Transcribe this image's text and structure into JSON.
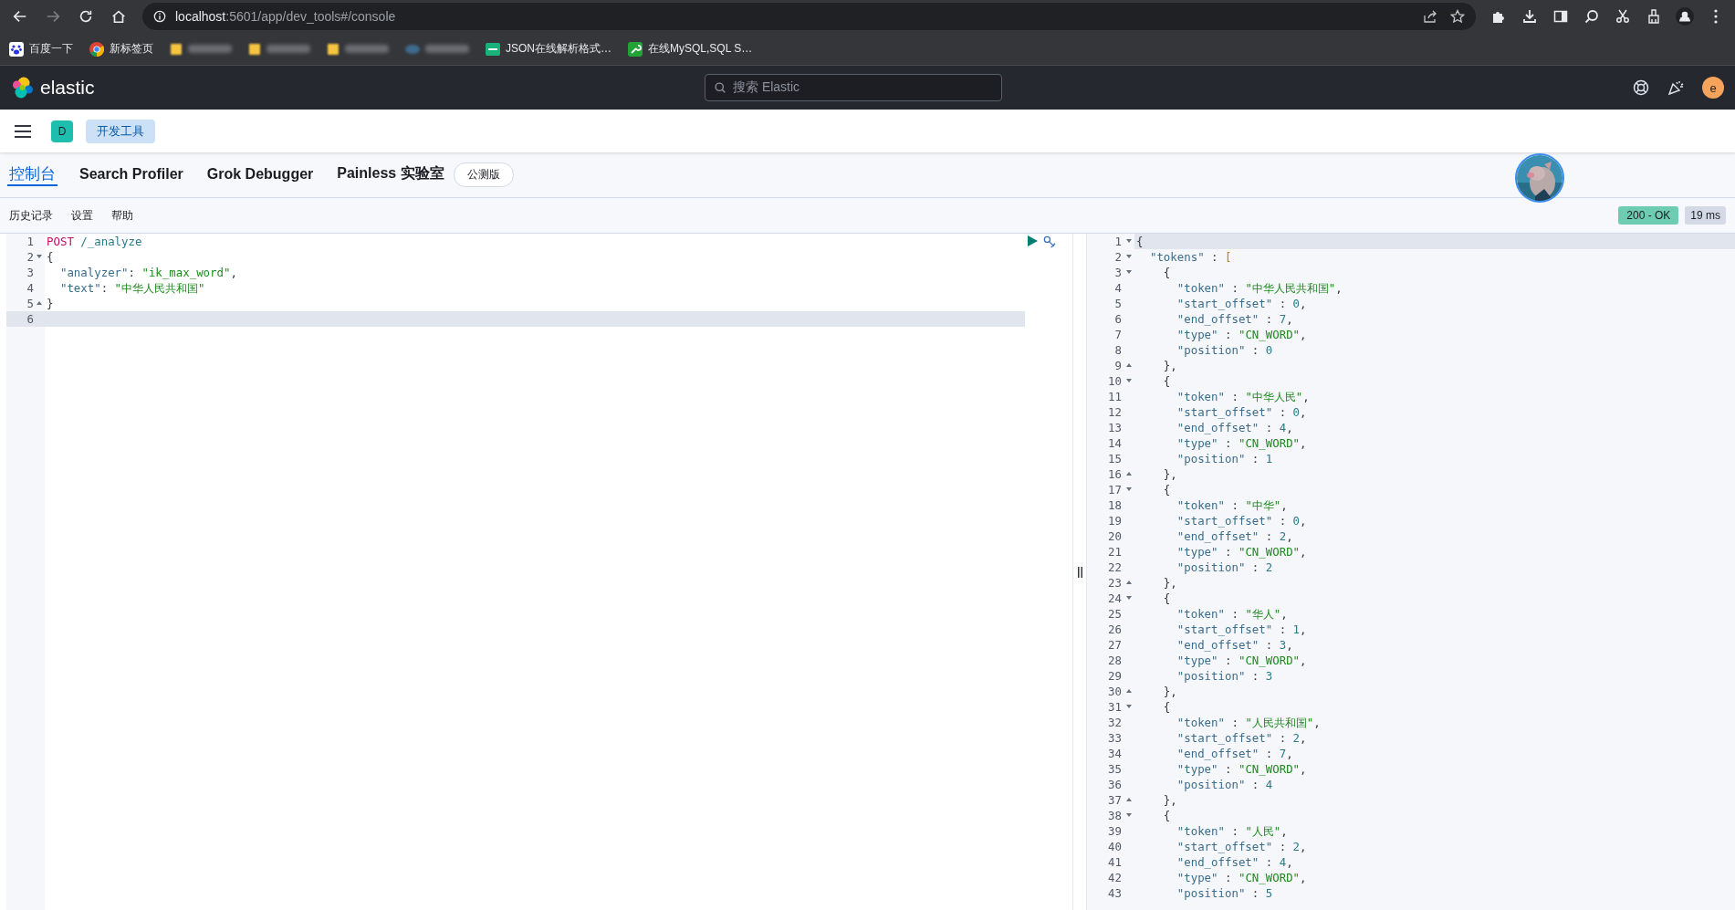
{
  "browser": {
    "nav_buttons": [
      {
        "kind": "back",
        "disabled": false
      },
      {
        "kind": "forward",
        "disabled": true
      },
      {
        "kind": "reload",
        "disabled": false
      },
      {
        "kind": "home",
        "disabled": false
      }
    ],
    "url_host": "localhost",
    "url_rest": ":5601/app/dev_tools#/console",
    "bookmarks": [
      {
        "kind": "site",
        "label": "百度一下"
      },
      {
        "kind": "site",
        "label": "新标签页"
      },
      {
        "kind": "blurred"
      },
      {
        "kind": "blurred"
      },
      {
        "kind": "blurred"
      },
      {
        "kind": "blurred"
      },
      {
        "kind": "site",
        "label": "JSON在线解析格式…"
      },
      {
        "kind": "site",
        "label": "在线MySQL,SQL S…"
      }
    ]
  },
  "header": {
    "logo_text": "elastic",
    "search_placeholder": "搜索 Elastic",
    "user_initial": "e"
  },
  "breadcrumbs": {
    "space_initial": "D",
    "crumb": "开发工具"
  },
  "tabs": [
    {
      "label": "控制台",
      "selected": true
    },
    {
      "label": "Search Profiler",
      "selected": false
    },
    {
      "label": "Grok Debugger",
      "selected": false
    },
    {
      "label": "Painless 实验室",
      "selected": false,
      "badge": "公测版"
    }
  ],
  "toolbar": [
    "历史记录",
    "设置",
    "帮助"
  ],
  "status": {
    "code": "200 - OK",
    "time": "19 ms"
  },
  "request": {
    "lines": [
      {
        "number": "1",
        "active": false,
        "tokens": [
          {
            "kind": "method",
            "text": "POST"
          },
          {
            "kind": "path",
            "text": " /_analyze"
          }
        ]
      },
      {
        "number": "2",
        "active": false,
        "fold_open": true,
        "tokens": [
          {
            "kind": "punct",
            "text": "{"
          }
        ]
      },
      {
        "number": "3",
        "active": false,
        "tokens": [
          {
            "kind": "key",
            "text": "  \"analyzer\""
          },
          {
            "kind": "punct",
            "text": ": "
          },
          {
            "kind": "string",
            "text": "\"ik_max_word\""
          },
          {
            "kind": "punct",
            "text": ","
          }
        ]
      },
      {
        "number": "4",
        "active": false,
        "tokens": [
          {
            "kind": "key",
            "text": "  \"text\""
          },
          {
            "kind": "punct",
            "text": ": "
          },
          {
            "kind": "string",
            "text": "\"中华人民共和国\""
          }
        ]
      },
      {
        "number": "5",
        "active": false,
        "fold_close": true,
        "tokens": [
          {
            "kind": "punct",
            "text": "}"
          }
        ]
      },
      {
        "number": "6",
        "active": true
      }
    ]
  },
  "response": {
    "lines": [
      {
        "number": "1",
        "active": true,
        "fold_open": true,
        "tokens": [
          {
            "kind": "punct",
            "text": "{"
          }
        ]
      },
      {
        "number": "2",
        "active": false,
        "fold_open": true,
        "tokens": [
          {
            "kind": "key",
            "text": "  \"tokens\""
          },
          {
            "kind": "punct",
            "text": " : "
          },
          {
            "kind": "bracket",
            "text": "["
          }
        ]
      },
      {
        "number": "3",
        "active": false,
        "fold_open": true,
        "tokens": [
          {
            "kind": "punct",
            "text": "    {"
          }
        ]
      },
      {
        "number": "4",
        "active": false,
        "tokens": [
          {
            "kind": "key",
            "text": "      \"token\""
          },
          {
            "kind": "punct",
            "text": " : "
          },
          {
            "kind": "string",
            "text": "\"中华人民共和国\""
          },
          {
            "kind": "punct",
            "text": ","
          }
        ]
      },
      {
        "number": "5",
        "active": false,
        "tokens": [
          {
            "kind": "key",
            "text": "      \"start_offset\""
          },
          {
            "kind": "punct",
            "text": " : "
          },
          {
            "kind": "number",
            "text": "0"
          },
          {
            "kind": "punct",
            "text": ","
          }
        ]
      },
      {
        "number": "6",
        "active": false,
        "tokens": [
          {
            "kind": "key",
            "text": "      \"end_offset\""
          },
          {
            "kind": "punct",
            "text": " : "
          },
          {
            "kind": "number",
            "text": "7"
          },
          {
            "kind": "punct",
            "text": ","
          }
        ]
      },
      {
        "number": "7",
        "active": false,
        "tokens": [
          {
            "kind": "key",
            "text": "      \"type\""
          },
          {
            "kind": "punct",
            "text": " : "
          },
          {
            "kind": "string",
            "text": "\"CN_WORD\""
          },
          {
            "kind": "punct",
            "text": ","
          }
        ]
      },
      {
        "number": "8",
        "active": false,
        "tokens": [
          {
            "kind": "key",
            "text": "      \"position\""
          },
          {
            "kind": "punct",
            "text": " : "
          },
          {
            "kind": "number",
            "text": "0"
          }
        ]
      },
      {
        "number": "9",
        "active": false,
        "fold_close": true,
        "tokens": [
          {
            "kind": "punct",
            "text": "    },"
          }
        ]
      },
      {
        "number": "10",
        "active": false,
        "fold_open": true,
        "tokens": [
          {
            "kind": "punct",
            "text": "    {"
          }
        ]
      },
      {
        "number": "11",
        "active": false,
        "tokens": [
          {
            "kind": "key",
            "text": "      \"token\""
          },
          {
            "kind": "punct",
            "text": " : "
          },
          {
            "kind": "string",
            "text": "\"中华人民\""
          },
          {
            "kind": "punct",
            "text": ","
          }
        ]
      },
      {
        "number": "12",
        "active": false,
        "tokens": [
          {
            "kind": "key",
            "text": "      \"start_offset\""
          },
          {
            "kind": "punct",
            "text": " : "
          },
          {
            "kind": "number",
            "text": "0"
          },
          {
            "kind": "punct",
            "text": ","
          }
        ]
      },
      {
        "number": "13",
        "active": false,
        "tokens": [
          {
            "kind": "key",
            "text": "      \"end_offset\""
          },
          {
            "kind": "punct",
            "text": " : "
          },
          {
            "kind": "number",
            "text": "4"
          },
          {
            "kind": "punct",
            "text": ","
          }
        ]
      },
      {
        "number": "14",
        "active": false,
        "tokens": [
          {
            "kind": "key",
            "text": "      \"type\""
          },
          {
            "kind": "punct",
            "text": " : "
          },
          {
            "kind": "string",
            "text": "\"CN_WORD\""
          },
          {
            "kind": "punct",
            "text": ","
          }
        ]
      },
      {
        "number": "15",
        "active": false,
        "tokens": [
          {
            "kind": "key",
            "text": "      \"position\""
          },
          {
            "kind": "punct",
            "text": " : "
          },
          {
            "kind": "number",
            "text": "1"
          }
        ]
      },
      {
        "number": "16",
        "active": false,
        "fold_close": true,
        "tokens": [
          {
            "kind": "punct",
            "text": "    },"
          }
        ]
      },
      {
        "number": "17",
        "active": false,
        "fold_open": true,
        "tokens": [
          {
            "kind": "punct",
            "text": "    {"
          }
        ]
      },
      {
        "number": "18",
        "active": false,
        "tokens": [
          {
            "kind": "key",
            "text": "      \"token\""
          },
          {
            "kind": "punct",
            "text": " : "
          },
          {
            "kind": "string",
            "text": "\"中华\""
          },
          {
            "kind": "punct",
            "text": ","
          }
        ]
      },
      {
        "number": "19",
        "active": false,
        "tokens": [
          {
            "kind": "key",
            "text": "      \"start_offset\""
          },
          {
            "kind": "punct",
            "text": " : "
          },
          {
            "kind": "number",
            "text": "0"
          },
          {
            "kind": "punct",
            "text": ","
          }
        ]
      },
      {
        "number": "20",
        "active": false,
        "tokens": [
          {
            "kind": "key",
            "text": "      \"end_offset\""
          },
          {
            "kind": "punct",
            "text": " : "
          },
          {
            "kind": "number",
            "text": "2"
          },
          {
            "kind": "punct",
            "text": ","
          }
        ]
      },
      {
        "number": "21",
        "active": false,
        "tokens": [
          {
            "kind": "key",
            "text": "      \"type\""
          },
          {
            "kind": "punct",
            "text": " : "
          },
          {
            "kind": "string",
            "text": "\"CN_WORD\""
          },
          {
            "kind": "punct",
            "text": ","
          }
        ]
      },
      {
        "number": "22",
        "active": false,
        "tokens": [
          {
            "kind": "key",
            "text": "      \"position\""
          },
          {
            "kind": "punct",
            "text": " : "
          },
          {
            "kind": "number",
            "text": "2"
          }
        ]
      },
      {
        "number": "23",
        "active": false,
        "fold_close": true,
        "tokens": [
          {
            "kind": "punct",
            "text": "    },"
          }
        ]
      },
      {
        "number": "24",
        "active": false,
        "fold_open": true,
        "tokens": [
          {
            "kind": "punct",
            "text": "    {"
          }
        ]
      },
      {
        "number": "25",
        "active": false,
        "tokens": [
          {
            "kind": "key",
            "text": "      \"token\""
          },
          {
            "kind": "punct",
            "text": " : "
          },
          {
            "kind": "string",
            "text": "\"华人\""
          },
          {
            "kind": "punct",
            "text": ","
          }
        ]
      },
      {
        "number": "26",
        "active": false,
        "tokens": [
          {
            "kind": "key",
            "text": "      \"start_offset\""
          },
          {
            "kind": "punct",
            "text": " : "
          },
          {
            "kind": "number",
            "text": "1"
          },
          {
            "kind": "punct",
            "text": ","
          }
        ]
      },
      {
        "number": "27",
        "active": false,
        "tokens": [
          {
            "kind": "key",
            "text": "      \"end_offset\""
          },
          {
            "kind": "punct",
            "text": " : "
          },
          {
            "kind": "number",
            "text": "3"
          },
          {
            "kind": "punct",
            "text": ","
          }
        ]
      },
      {
        "number": "28",
        "active": false,
        "tokens": [
          {
            "kind": "key",
            "text": "      \"type\""
          },
          {
            "kind": "punct",
            "text": " : "
          },
          {
            "kind": "string",
            "text": "\"CN_WORD\""
          },
          {
            "kind": "punct",
            "text": ","
          }
        ]
      },
      {
        "number": "29",
        "active": false,
        "tokens": [
          {
            "kind": "key",
            "text": "      \"position\""
          },
          {
            "kind": "punct",
            "text": " : "
          },
          {
            "kind": "number",
            "text": "3"
          }
        ]
      },
      {
        "number": "30",
        "active": false,
        "fold_close": true,
        "tokens": [
          {
            "kind": "punct",
            "text": "    },"
          }
        ]
      },
      {
        "number": "31",
        "active": false,
        "fold_open": true,
        "tokens": [
          {
            "kind": "punct",
            "text": "    {"
          }
        ]
      },
      {
        "number": "32",
        "active": false,
        "tokens": [
          {
            "kind": "key",
            "text": "      \"token\""
          },
          {
            "kind": "punct",
            "text": " : "
          },
          {
            "kind": "string",
            "text": "\"人民共和国\""
          },
          {
            "kind": "punct",
            "text": ","
          }
        ]
      },
      {
        "number": "33",
        "active": false,
        "tokens": [
          {
            "kind": "key",
            "text": "      \"start_offset\""
          },
          {
            "kind": "punct",
            "text": " : "
          },
          {
            "kind": "number",
            "text": "2"
          },
          {
            "kind": "punct",
            "text": ","
          }
        ]
      },
      {
        "number": "34",
        "active": false,
        "tokens": [
          {
            "kind": "key",
            "text": "      \"end_offset\""
          },
          {
            "kind": "punct",
            "text": " : "
          },
          {
            "kind": "number",
            "text": "7"
          },
          {
            "kind": "punct",
            "text": ","
          }
        ]
      },
      {
        "number": "35",
        "active": false,
        "tokens": [
          {
            "kind": "key",
            "text": "      \"type\""
          },
          {
            "kind": "punct",
            "text": " : "
          },
          {
            "kind": "string",
            "text": "\"CN_WORD\""
          },
          {
            "kind": "punct",
            "text": ","
          }
        ]
      },
      {
        "number": "36",
        "active": false,
        "tokens": [
          {
            "kind": "key",
            "text": "      \"position\""
          },
          {
            "kind": "punct",
            "text": " : "
          },
          {
            "kind": "number",
            "text": "4"
          }
        ]
      },
      {
        "number": "37",
        "active": false,
        "fold_close": true,
        "tokens": [
          {
            "kind": "punct",
            "text": "    },"
          }
        ]
      },
      {
        "number": "38",
        "active": false,
        "fold_open": true,
        "tokens": [
          {
            "kind": "punct",
            "text": "    {"
          }
        ]
      },
      {
        "number": "39",
        "active": false,
        "tokens": [
          {
            "kind": "key",
            "text": "      \"token\""
          },
          {
            "kind": "punct",
            "text": " : "
          },
          {
            "kind": "string",
            "text": "\"人民\""
          },
          {
            "kind": "punct",
            "text": ","
          }
        ]
      },
      {
        "number": "40",
        "active": false,
        "tokens": [
          {
            "kind": "key",
            "text": "      \"start_offset\""
          },
          {
            "kind": "punct",
            "text": " : "
          },
          {
            "kind": "number",
            "text": "2"
          },
          {
            "kind": "punct",
            "text": ","
          }
        ]
      },
      {
        "number": "41",
        "active": false,
        "tokens": [
          {
            "kind": "key",
            "text": "      \"end_offset\""
          },
          {
            "kind": "punct",
            "text": " : "
          },
          {
            "kind": "number",
            "text": "4"
          },
          {
            "kind": "punct",
            "text": ","
          }
        ]
      },
      {
        "number": "42",
        "active": false,
        "tokens": [
          {
            "kind": "key",
            "text": "      \"type\""
          },
          {
            "kind": "punct",
            "text": " : "
          },
          {
            "kind": "string",
            "text": "\"CN_WORD\""
          },
          {
            "kind": "punct",
            "text": ","
          }
        ]
      },
      {
        "number": "43",
        "active": false,
        "tokens": [
          {
            "kind": "key",
            "text": "      \"position\""
          },
          {
            "kind": "punct",
            "text": " : "
          },
          {
            "kind": "number",
            "text": "5"
          }
        ]
      }
    ]
  }
}
